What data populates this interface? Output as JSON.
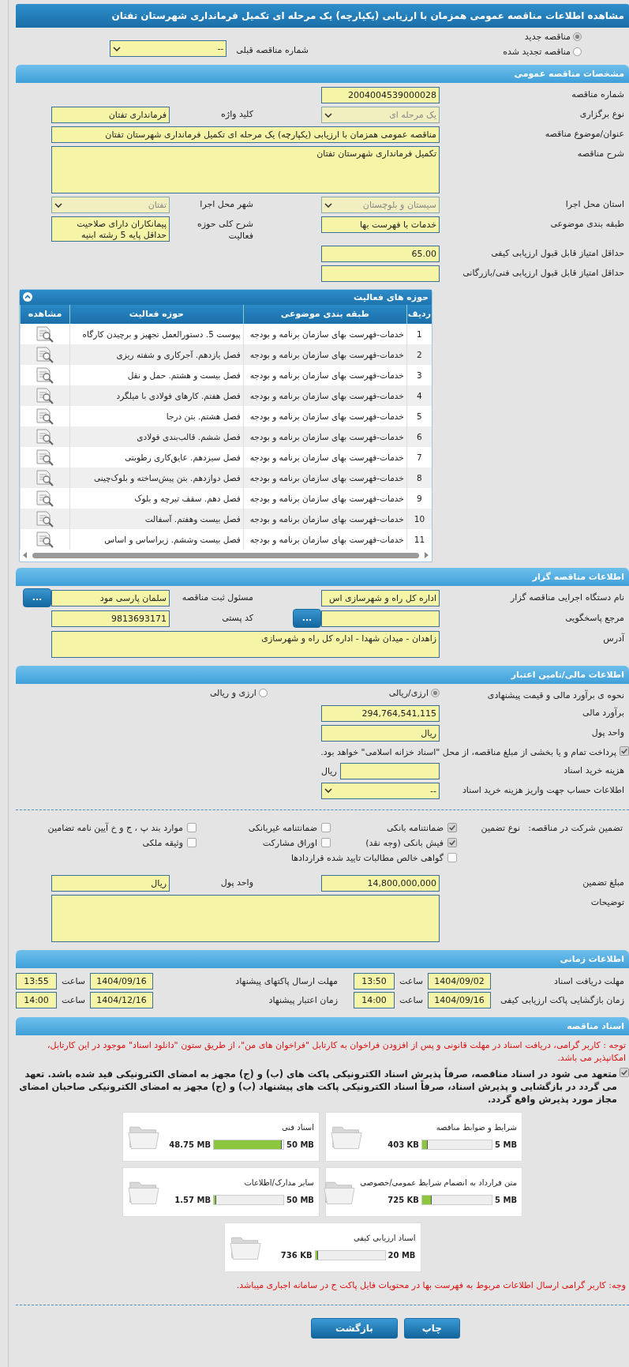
{
  "title": "مشاهده اطلاعات مناقصه عمومی همزمان با ارزیابی (یکپارچه) یک مرحله ای تکمیل فرمانداری شهرستان تفتان",
  "tender_type": {
    "options": [
      {
        "label": "مناقصه جدید",
        "selected": true
      },
      {
        "label": "مناقصه تجدید شده",
        "selected": false
      }
    ],
    "previous": {
      "label": "شماره مناقصه قبلی",
      "value": "--",
      "disabled": false
    }
  },
  "sections": [
    {
      "heading": "مشخصات مناقصه عمومی",
      "parts": [
        {
          "kind": "form",
          "rows": [
            [
              {
                "kind": "text",
                "label": "شماره مناقصه",
                "value": "2004004539000028"
              }
            ],
            [
              {
                "kind": "select",
                "label": "نوع برگزاری",
                "value": "یک مرحله ای",
                "disabled": true
              },
              {
                "kind": "text",
                "label": "کلید واژه",
                "value": "فرمانداری تفتان"
              }
            ],
            [
              {
                "kind": "wide_text",
                "label": "عنوان/موضوع مناقصه",
                "value": "مناقصه عمومی همزمان با ارزیابی (یکپارچه) یک مرحله ای تکمیل فرمانداری شهرستان تفتان"
              }
            ],
            [
              {
                "kind": "wide_area",
                "label": "شرح مناقصه",
                "value": "تکمیل فرمانداری شهرستان تفتان"
              }
            ],
            [
              {
                "kind": "select",
                "label": "استان محل اجرا",
                "value": "سیستان و بلوچستان",
                "disabled": true
              },
              {
                "kind": "select",
                "label": "شهر محل اجرا",
                "value": "تفتان",
                "disabled": true
              }
            ],
            [
              {
                "kind": "text",
                "label": "طبقه بندی موضوعی",
                "value": "خدمات با فهرست بها"
              },
              {
                "kind": "area",
                "label": "شرح کلی حوزه فعالیت",
                "value": "پیمانکاران دارای صلاحیت حداقل پایه 5 رشته ابنیه"
              }
            ],
            [
              {
                "kind": "text",
                "label": "حداقل امتیاز قابل قبول ارزیابی کیفی",
                "value": "65.00"
              }
            ],
            [
              {
                "kind": "text",
                "label": "حداقل امتیاز قابل قبول ارزیابی فنی/بازرگانی"
              }
            ]
          ]
        },
        {
          "kind": "table",
          "title": "حوزه های فعالیت",
          "columns": [
            "ردیف",
            "طبقه بندی موضوعی",
            "حوزه فعالیت",
            "مشاهده"
          ],
          "rows": [
            {
              "index": "1",
              "category": "خدمات-فهرست بهای سازمان برنامه و بودجه",
              "activity": "پیوست 5. دستورالعمل تجهیز و برچیدن کارگاه"
            },
            {
              "index": "2",
              "category": "خدمات-فهرست بهای سازمان برنامه و بودجه",
              "activity": "فصل یازدهم. آجرکاری و شفته ریزی"
            },
            {
              "index": "3",
              "category": "خدمات-فهرست بهای سازمان برنامه و بودجه",
              "activity": "فصل بیست و هشتم. حمل و نقل"
            },
            {
              "index": "4",
              "category": "خدمات-فهرست بهای سازمان برنامه و بودجه",
              "activity": "فصل هفتم. کارهای فولادی با میلگرد"
            },
            {
              "index": "5",
              "category": "خدمات-فهرست بهای سازمان برنامه و بودجه",
              "activity": "فصل هشتم. بتن درجا"
            },
            {
              "index": "6",
              "category": "خدمات-فهرست بهای سازمان برنامه و بودجه",
              "activity": "فصل ششم. قالب‌بندی فولادی"
            },
            {
              "index": "7",
              "category": "خدمات-فهرست بهای سازمان برنامه و بودجه",
              "activity": "فصل سیزدهم. عایق‌کاری رطوبتی"
            },
            {
              "index": "8",
              "category": "خدمات-فهرست بهای سازمان برنامه و بودجه",
              "activity": "فصل دوازدهم. بتن پیش‌ساخته و بلوک‌چینی"
            },
            {
              "index": "9",
              "category": "خدمات-فهرست بهای سازمان برنامه و بودجه",
              "activity": "فصل دهم. سقف تیرچه و بلوک"
            },
            {
              "index": "10",
              "category": "خدمات-فهرست بهای سازمان برنامه و بودجه",
              "activity": "فصل بیست وهفتم. آسفالت"
            },
            {
              "index": "11",
              "category": "خدمات-فهرست بهای سازمان برنامه و بودجه",
              "activity": "فصل بیست وششم. زیراساس و اساس"
            }
          ]
        }
      ]
    },
    {
      "heading": "اطلاعات مناقصه گزار",
      "parts": [
        {
          "kind": "form",
          "rows": [
            [
              {
                "kind": "text",
                "label": "نام دستگاه اجرایی مناقصه گزار",
                "value": "اداره کل راه و شهرسازی اس"
              },
              {
                "kind": "text",
                "label": "مسئول ثبت مناقصه",
                "value": "سلمان پارسی مود",
                "button": "..."
              }
            ],
            [
              {
                "kind": "text",
                "label": "مرجع پاسخگویی",
                "button": "..."
              },
              {
                "kind": "text",
                "label": "کد پستی",
                "value": "9813693171"
              }
            ],
            [
              {
                "kind": "wide_area_small",
                "label": "آدرس",
                "value": "زاهدان - میدان شهدا - اداره کل راه و شهرسازی"
              }
            ]
          ]
        }
      ]
    },
    {
      "heading": "اطلاعات مالی/تامین اعتبار",
      "parts": [
        {
          "kind": "form",
          "rows": [
            [
              {
                "kind": "radio",
                "label": "نحوه ی برآورد مالی و قیمت پیشنهادی",
                "options": [
                  {
                    "label": "ارزی/ریالی",
                    "selected": true
                  },
                  {
                    "label": "ارزی و ریالی",
                    "selected": false
                  }
                ]
              }
            ],
            [
              {
                "kind": "text",
                "label": "برآورد مالی",
                "value": "294,764,541,115"
              }
            ],
            [
              {
                "kind": "text",
                "label": "واحد پول",
                "value": "ریال"
              }
            ],
            [
              {
                "kind": "checkbox",
                "label": "پرداخت تمام و یا بخشی از مبلغ مناقصه، از محل \"اسناد خزانه اسلامی\" خواهد بود.",
                "checked": true
              }
            ],
            [
              {
                "kind": "text",
                "label": "هزینه خرید اسناد",
                "suffix": "ریال"
              }
            ],
            [
              {
                "kind": "select",
                "label": "اطلاعات حساب جهت واریز هزینه خرید اسناد",
                "value": "--",
                "disabled": false
              }
            ]
          ]
        },
        {
          "kind": "guarantee",
          "label": "تضمین شرکت در مناقصه:",
          "type_label": "نوع تضمین",
          "options": [
            {
              "label": "ضمانتنامه بانکی",
              "checked": true
            },
            {
              "label": "ضمانتنامه غیربانکی",
              "checked": false
            },
            {
              "label": "موارد بند پ ، ج و خ آیین نامه تضامین",
              "checked": false
            },
            {
              "label": "فیش بانکی (وجه نقد)",
              "checked": true
            },
            {
              "label": "اوراق مشارکت",
              "checked": false
            },
            {
              "label": "وثیقه ملکی",
              "checked": false
            },
            {
              "label": "گواهی خالص مطالبات تایید شده قراردادها",
              "checked": false
            }
          ]
        },
        {
          "kind": "form",
          "rows": [
            [
              {
                "kind": "text",
                "label": "مبلغ تضمین",
                "value": "14,800,000,000"
              },
              {
                "kind": "text",
                "label": "واحد پول",
                "value": "ریال"
              }
            ],
            [
              {
                "kind": "wide_area",
                "label": "توضیحات"
              }
            ]
          ]
        }
      ]
    },
    {
      "heading": "اطلاعات زمانی",
      "parts": [
        {
          "kind": "timing",
          "rows": [
            [
              {
                "label": "مهلت دریافت اسناد",
                "date": "1404/09/02",
                "time_label": "ساعت",
                "time": "13:50"
              },
              {
                "label": "مهلت ارسال پاکتهای پیشنهاد",
                "date": "1404/09/16",
                "time_label": "ساعت",
                "time": "13:55"
              }
            ],
            [
              {
                "label": "زمان بازگشایی پاکت ارزیابی کیفی",
                "date": "1404/09/16",
                "time_label": "ساعت",
                "time": "14:00"
              },
              {
                "label": "زمان اعتبار پیشنهاد",
                "date": "1404/12/16",
                "time_label": "ساعت",
                "time": "14:00"
              }
            ]
          ]
        }
      ]
    },
    {
      "heading": "اسناد مناقصه",
      "parts": [
        {
          "kind": "notice",
          "text": "توجه : کاربر گرامی، دریافت اسناد در مهلت قانونی و پس از افزودن فراخوان به کارتابل \"فراخوان های من\"، از طریق ستون \"دانلود اسناد\" موجود در این کارتابل، امکانپذیر می باشد."
        },
        {
          "kind": "commitment",
          "checked": true,
          "text": "متعهد می شود در اسناد مناقصه، صرفاً پذیرش اسناد الکترونیکی پاکت های (ب) و (ج) مجهز به امضای الکترونیکی قید شده باشد. تعهد می گردد در بازگشایی و پذیرش اسناد، صرفاً اسناد الکترونیکی پاکت های پیشنهاد (ب) و (ج) مجهز به امضای الکترونیکی صاحبان امضای مجاز مورد پذیرش واقع گردد."
        },
        {
          "kind": "files",
          "items": [
            {
              "title": "شرایط و ضوابط مناقصه",
              "size": "403 KB",
              "max": "5 MB",
              "level": 0.08
            },
            {
              "title": "اسناد فنی",
              "size": "48.75 MB",
              "max": "50 MB",
              "level": 0.975
            },
            {
              "title": "متن قرارداد به انضمام شرایط عمومی/خصوصی",
              "size": "725 KB",
              "max": "5 MB",
              "level": 0.14
            },
            {
              "title": "سایر مدارک/اطلاعات",
              "size": "1.57 MB",
              "max": "50 MB",
              "level": 0.03
            },
            {
              "title": "اسناد ارزیابی کیفی",
              "size": "736 KB",
              "max": "20 MB",
              "level": 0.04
            }
          ]
        },
        {
          "kind": "notice",
          "text": "وجه: کاربر گرامی ارسال اطلاعات مربوط به فهرست بها در محتویات فایل پاکت ج در سامانه اجباری میباشد."
        }
      ]
    }
  ],
  "buttons": [
    {
      "label": "چاپ"
    },
    {
      "label": "بازگشت"
    }
  ]
}
